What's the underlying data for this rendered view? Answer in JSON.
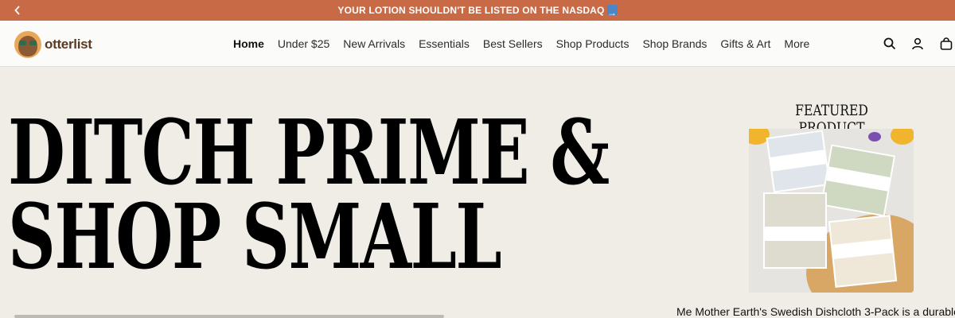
{
  "announcement": {
    "text": "YOUR LOTION SHOULDN'T BE LISTED ON THE NASDAQ",
    "emoji": "right-arrow-emoji"
  },
  "brand": {
    "name": "otterlist"
  },
  "nav": [
    {
      "label": "Home",
      "active": true
    },
    {
      "label": "Under $25"
    },
    {
      "label": "New Arrivals"
    },
    {
      "label": "Essentials"
    },
    {
      "label": "Best Sellers"
    },
    {
      "label": "Shop Products"
    },
    {
      "label": "Shop Brands"
    },
    {
      "label": "Gifts & Art"
    },
    {
      "label": "More"
    }
  ],
  "header_icons": [
    "search-icon",
    "account-icon",
    "cart-icon"
  ],
  "hero": {
    "line1": "DITCH PRIME &",
    "line2": "SHOP SMALL"
  },
  "featured": {
    "title": "FEATURED PRODUCT",
    "caption": "Me Mother Earth's Swedish Dishcloth 3-Pack is a durable"
  },
  "colors": {
    "accent": "#c96a47",
    "background": "#f0ede6",
    "header": "#fbfbfa"
  }
}
